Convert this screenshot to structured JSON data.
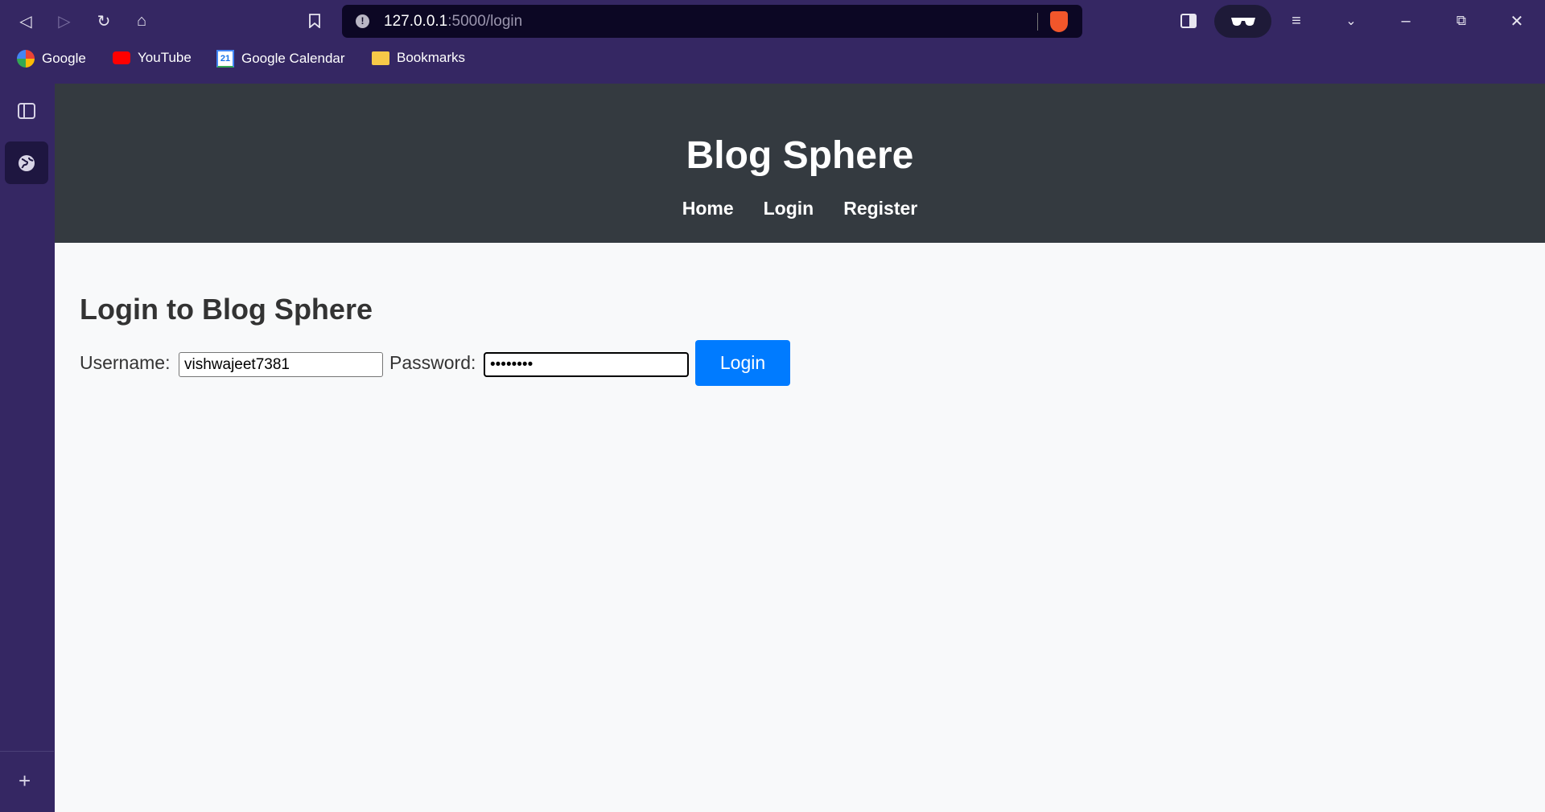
{
  "browser": {
    "url_host": "127.0.0.1",
    "url_path": ":5000/login",
    "bookmarks": [
      {
        "label": "Google",
        "icon": "google-icon"
      },
      {
        "label": "YouTube",
        "icon": "youtube-icon"
      },
      {
        "label": "Google Calendar",
        "icon": "calendar-icon",
        "badge": "21"
      },
      {
        "label": "Bookmarks",
        "icon": "folder-icon"
      }
    ]
  },
  "site": {
    "title": "Blog Sphere",
    "nav": [
      "Home",
      "Login",
      "Register"
    ]
  },
  "login": {
    "heading": "Login to Blog Sphere",
    "username_label": "Username:",
    "username_value": "vishwajeet7381",
    "password_label": "Password:",
    "password_value": "••••••••",
    "submit_label": "Login"
  },
  "colors": {
    "header": "#343a40",
    "button": "#007bff",
    "browser": "#352763"
  }
}
